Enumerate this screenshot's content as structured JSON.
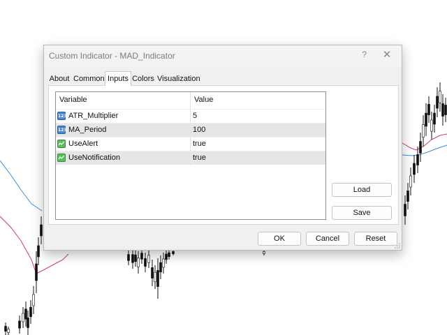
{
  "dialog": {
    "title": "Custom Indicator - MAD_Indicator",
    "help_label": "?",
    "close_label": "✕"
  },
  "tabs": [
    {
      "label": "About"
    },
    {
      "label": "Common"
    },
    {
      "label": "Inputs",
      "active": true
    },
    {
      "label": "Colors"
    },
    {
      "label": "Visualization"
    }
  ],
  "inputs_table": {
    "headers": {
      "variable": "Variable",
      "value": "Value"
    },
    "rows": [
      {
        "icon": "numeric-type-icon",
        "icon_text": "123",
        "variable": "ATR_Multiplier",
        "value": "5"
      },
      {
        "icon": "numeric-type-icon",
        "icon_text": "123",
        "variable": "MA_Period",
        "value": "100"
      },
      {
        "icon": "boolean-type-icon",
        "variable": "UseAlert",
        "value": "true"
      },
      {
        "icon": "boolean-type-icon",
        "variable": "UseNotification",
        "value": "true"
      }
    ]
  },
  "side_buttons": {
    "load": "Load",
    "save": "Save"
  },
  "footer_buttons": {
    "ok": "OK",
    "cancel": "Cancel",
    "reset": "Reset"
  },
  "colors": {
    "chart_line_blue": "#3a8fd8",
    "chart_line_magenta": "#d1347a",
    "candles": "#111111"
  }
}
